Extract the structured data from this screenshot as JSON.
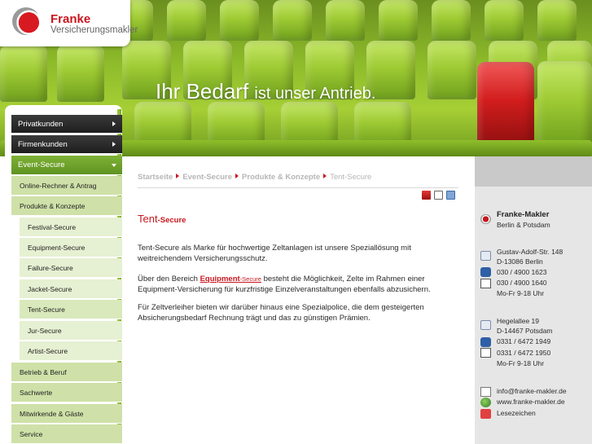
{
  "brand": {
    "name": "Franke",
    "subtitle": "Versicherungsmakler",
    "colors": {
      "accent": "#c8161e",
      "green": "#7fb236",
      "dark": "#1e1e1e"
    }
  },
  "hero": {
    "slogan_word1": "Ihr Bedarf",
    "slogan_rest": "ist unser Antrieb."
  },
  "nav": {
    "main": [
      {
        "label": "Privatkunden"
      },
      {
        "label": "Firmenkunden"
      },
      {
        "label": "Event-Secure"
      }
    ],
    "sub": [
      {
        "label": "Online-Rechner & Antrag"
      },
      {
        "label": "Produkte & Konzepte"
      }
    ],
    "products": [
      {
        "label": "Festival-Secure"
      },
      {
        "label": "Equipment-Secure"
      },
      {
        "label": "Failure-Secure"
      },
      {
        "label": "Jacket-Secure"
      },
      {
        "label": "Tent-Secure"
      },
      {
        "label": "Jur-Secure"
      },
      {
        "label": "Artist-Secure"
      }
    ],
    "sub_after": [
      {
        "label": "Betrieb & Beruf"
      },
      {
        "label": "Sachwerte"
      },
      {
        "label": "Mitwirkende & Gäste"
      },
      {
        "label": "Service"
      }
    ]
  },
  "breadcrumb": [
    "Startseite",
    "Event-Secure",
    "Produkte & Konzepte",
    "Tent-Secure"
  ],
  "toolbar_icons": [
    "pdf-icon",
    "print-icon",
    "email-icon"
  ],
  "content": {
    "title_main": "Tent",
    "title_suffix": "-Secure",
    "p1": "Tent-Secure als Marke für hochwertige Zeltanlagen ist unsere Speziallösung mit weitreichendem Versicherungsschutz.",
    "p2_before": "Über den Bereich ",
    "p2_link": "Equipment",
    "p2_link_suffix": "-Secure",
    "p2_after": " besteht die Möglichkeit, Zelte im Rahmen einer Equipment-Versicherung für kurzfristige Einzelveranstaltungen ebenfalls abzusichern.",
    "p3": "Für Zeltverleiher bieten wir darüber hinaus eine Spezialpolice, die dem gesteigerten Absicherungsbedarf Rechnung trägt und das zu günstigen Prämien."
  },
  "contact": {
    "company": "Franke-Makler",
    "cities": "Berlin & Potsdam",
    "berlin": {
      "street": "Gustav-Adolf-Str. 148",
      "zip": "D-13086 Berlin",
      "phone": "030 / 4900 1623",
      "fax": "030 / 4900 1640",
      "hours": "Mo-Fr 9-18 Uhr"
    },
    "potsdam": {
      "street": "Hegelallee 19",
      "zip": "D-14467 Potsdam",
      "phone": "0331 / 6472 1949",
      "fax": "0331 / 6472 1950",
      "hours": "Mo-Fr 9-18 Uhr"
    },
    "email": "info@franke-makler.de",
    "web": "www.franke-makler.de",
    "bookmarks": "Lesezeichen"
  }
}
